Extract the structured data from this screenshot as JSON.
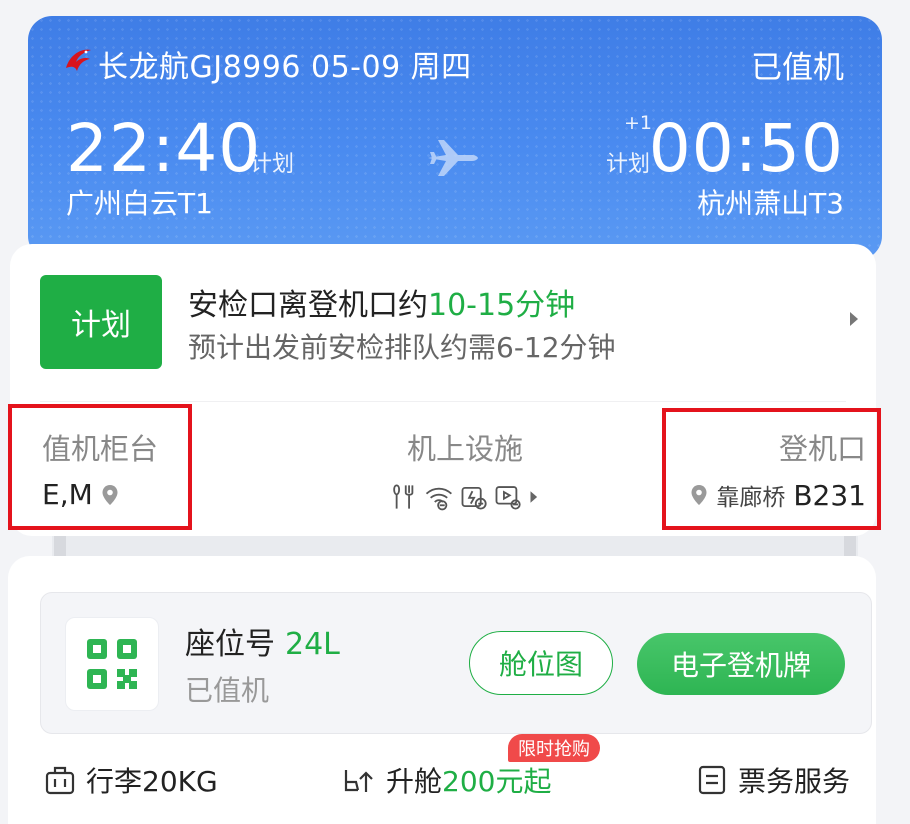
{
  "flight": {
    "title": "长龙航GJ8996 05-09 周四",
    "status": "已值机",
    "departure": {
      "time": "22:40",
      "plan_label": "计划",
      "airport": "广州白云T1"
    },
    "arrival": {
      "day_offset": "+1",
      "plan_label": "计划",
      "time": "00:50",
      "airport": "杭州萧山T3"
    }
  },
  "security": {
    "badge": "计划",
    "line1_prefix": "安检口离登机口约",
    "line1_highlight": "10-15分钟",
    "line2": "预计出发前安检排队约需6-12分钟"
  },
  "facilities": {
    "checkin": {
      "label": "值机柜台",
      "value": "E,M"
    },
    "onboard": {
      "label": "机上设施"
    },
    "gate": {
      "label": "登机口",
      "type": "靠廊桥",
      "number": "B231"
    }
  },
  "seat": {
    "label": "座位号",
    "number": "24L",
    "status": "已值机",
    "seatmap_button": "舱位图",
    "boarding_pass_button": "电子登机牌"
  },
  "bottom": {
    "baggage": "行李20KG",
    "upgrade_prefix": "升舱",
    "upgrade_price": "200元起",
    "promo": "限时抢购",
    "ticket_service": "票务服务"
  },
  "colors": {
    "header_blue": "#4a8bf0",
    "accent_green": "#1fae45",
    "highlight_red": "#e4131c"
  }
}
